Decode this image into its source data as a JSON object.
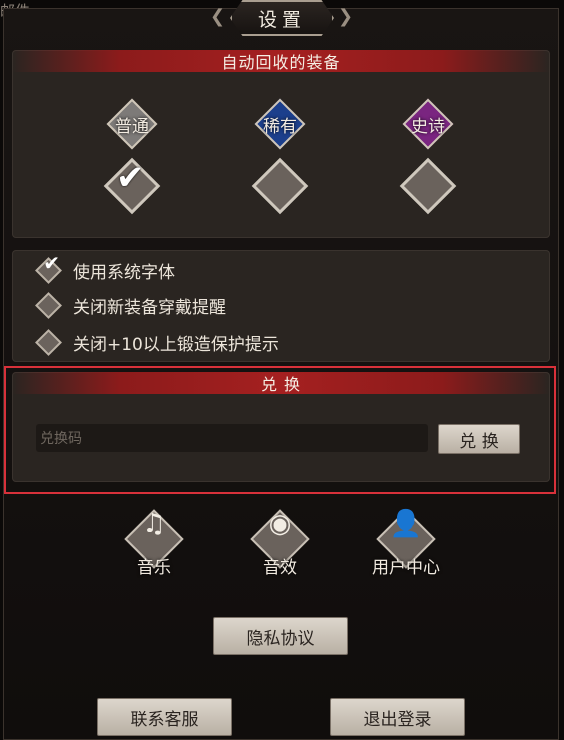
{
  "background": {
    "mail_label": "邮件"
  },
  "dialog": {
    "title": "设置"
  },
  "auto_recycle": {
    "header": "自动回收的装备",
    "grades": [
      {
        "label": "普通",
        "color": "#7d7a78",
        "checked": true
      },
      {
        "label": "稀有",
        "color": "#1c3f8c",
        "checked": false
      },
      {
        "label": "史诗",
        "color": "#7a2580",
        "checked": false
      }
    ]
  },
  "options": [
    {
      "label": "使用系统字体",
      "checked": true
    },
    {
      "label": "关闭新装备穿戴提醒",
      "checked": false
    },
    {
      "label": "关闭+10以上锻造保护提示",
      "checked": false
    }
  ],
  "redeem": {
    "header": "兑 换",
    "placeholder": "兑换码",
    "button_label": "兑 换"
  },
  "icons": [
    {
      "name": "music-icon",
      "label": "音乐"
    },
    {
      "name": "sound-effect-icon",
      "label": "音效"
    },
    {
      "name": "user-center-icon",
      "label": "用户中心"
    }
  ],
  "buttons": {
    "privacy": "隐私协议",
    "contact": "联系客服",
    "logout": "退出登录"
  }
}
